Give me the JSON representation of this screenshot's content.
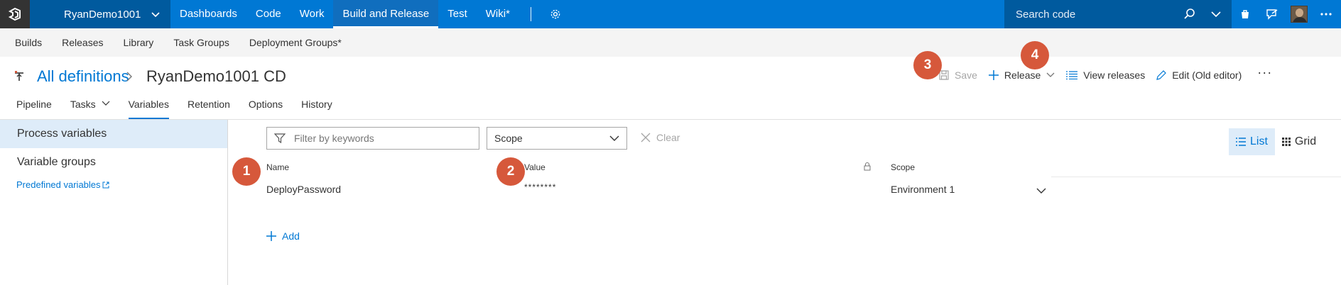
{
  "topbar": {
    "project": "RyanDemo1001",
    "hubs": [
      "Dashboards",
      "Code",
      "Work",
      "Build and Release",
      "Test",
      "Wiki*"
    ],
    "search_placeholder": "Search code"
  },
  "subnav": {
    "items": [
      "Builds",
      "Releases",
      "Library",
      "Task Groups",
      "Deployment Groups*"
    ]
  },
  "header": {
    "breadcrumb_link": "All definitions",
    "title": "RyanDemo1001 CD",
    "toolbar": {
      "save": "Save",
      "release": "Release",
      "view_releases": "View releases",
      "edit_old": "Edit (Old editor)",
      "more": "···"
    },
    "tabs": [
      "Pipeline",
      "Tasks",
      "Variables",
      "Retention",
      "Options",
      "History"
    ],
    "active_tab": "Variables"
  },
  "left_pane": {
    "process_variables": "Process variables",
    "variable_groups": "Variable groups",
    "predefined_variables": "Predefined variables"
  },
  "filter": {
    "placeholder": "Filter by keywords",
    "scope": "Scope",
    "clear": "Clear"
  },
  "view_toggle": {
    "list": "List",
    "grid": "Grid"
  },
  "table": {
    "headers": {
      "name": "Name",
      "value": "Value",
      "scope": "Scope"
    },
    "rows": [
      {
        "name": "DeployPassword",
        "value": "********",
        "scope": "Environment 1"
      }
    ]
  },
  "add_label": "Add",
  "callouts": [
    "1",
    "2",
    "3",
    "4"
  ],
  "colors": {
    "brand_blue": "#0078d4",
    "project_dark": "#005a9e",
    "callout": "#d6583b",
    "selected_bg": "#deecf9"
  }
}
